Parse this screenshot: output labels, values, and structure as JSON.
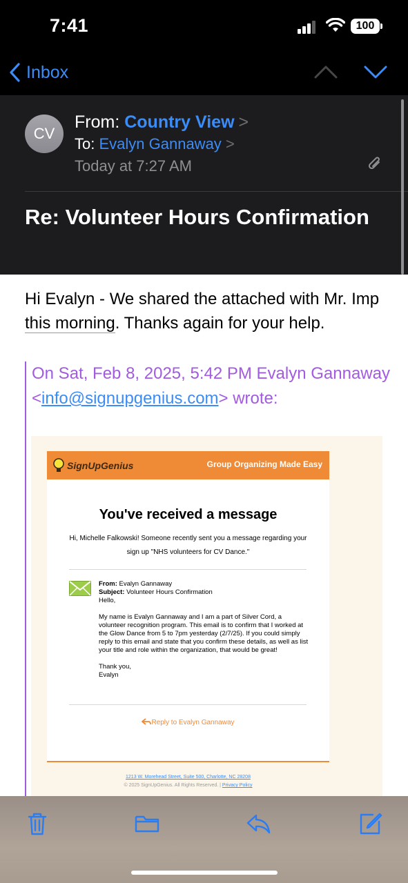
{
  "status_bar": {
    "time": "7:41",
    "battery": "100"
  },
  "nav": {
    "back_label": "Inbox"
  },
  "header": {
    "avatar_initials": "CV",
    "from_prefix": "From:",
    "from_name": "Country View",
    "to_prefix": "To:",
    "to_name": "Evalyn Gannaway",
    "date": "Today at 7:27 AM",
    "subject": "Re: Volunteer Hours Confirmation"
  },
  "body": {
    "line_start": "Hi Evalyn - We shared the attached with Mr. Imp ",
    "underlined": "this morning",
    "line_end": ". Thanks again for your help.",
    "quote_prefix": "On Sat, Feb 8, 2025, 5:42 PM Evalyn Gannaway <",
    "quote_email": "info@signupgenius.com",
    "quote_suffix": "> wrote:"
  },
  "embedded": {
    "logo_text": "SignUpGenius",
    "tagline": "Group Organizing Made Easy",
    "title": "You've received a message",
    "intro": "Hi, Michelle Falkowski! Someone recently sent you a message regarding your sign up \"NHS volunteers for CV Dance.\"",
    "from_label": "From:",
    "from_value": " Evalyn Gannaway",
    "subject_label": "Subject:",
    "subject_value": " Volunteer Hours Confirmation",
    "greeting": "Hello,",
    "message": "My name is Evalyn Gannaway and I am a part of Silver Cord, a volunteer recognition program. This email is to confirm that I worked at the Glow Dance from 5 to 7pm yesterday (2/7/25). If you could simply reply to this email and state that you confirm these details, as well as list your title and role within the organization, that would be great!",
    "signoff": "Thank you,",
    "signature": "Evalyn",
    "reply_label": "Reply to Evalyn Gannaway",
    "address": "1213 W. Morehead Street, Suite 500, Charlotte, NC 28208",
    "copyright": "© 2025 SignUpGenius. All Rights Reserved. | ",
    "privacy": "Privacy Policy"
  },
  "colors": {
    "accent": "#3b8cf7",
    "quote": "#a25be0",
    "sug_orange": "#ef8a36"
  },
  "toolbar": {
    "icons": [
      "trash-icon",
      "folder-icon",
      "reply-icon",
      "compose-icon"
    ]
  }
}
